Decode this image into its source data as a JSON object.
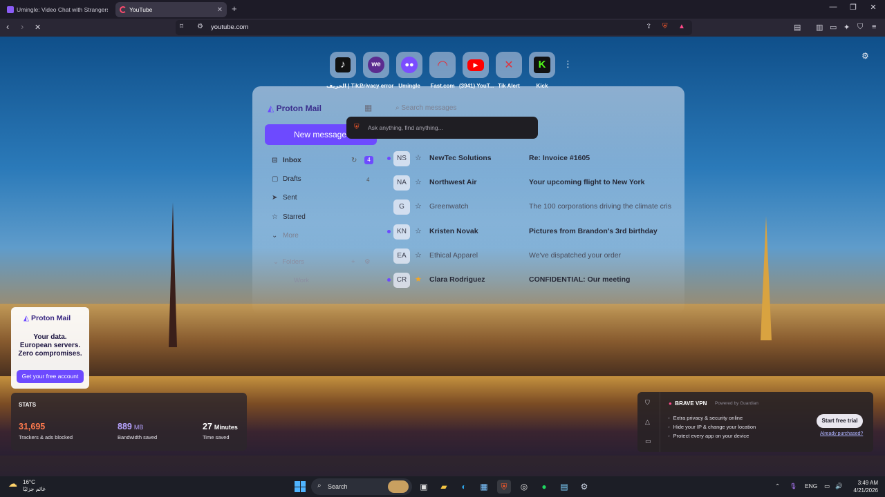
{
  "browser": {
    "tabs": [
      {
        "title": "Umingle: Video Chat with Strangers",
        "active": false
      },
      {
        "title": "YouTube",
        "active": true
      }
    ],
    "url": "youtube.com"
  },
  "speed_dial": [
    {
      "label": "الحريف | Tik...",
      "icon": "tiktok-icon",
      "glyph": "♪"
    },
    {
      "label": "Privacy error",
      "icon": "we-icon",
      "glyph": "we"
    },
    {
      "label": "Umingle",
      "icon": "chat-bubble-icon",
      "glyph": "💬"
    },
    {
      "label": "Fast.com",
      "icon": "speedometer-icon",
      "glyph": "◠"
    },
    {
      "label": "(3941) YouT...",
      "icon": "youtube-icon",
      "glyph": "▶"
    },
    {
      "label": "Tik Alert",
      "icon": "tik-alert-icon",
      "glyph": "✕"
    },
    {
      "label": "Kick",
      "icon": "kick-icon",
      "glyph": "K"
    }
  ],
  "protonmail_preview": {
    "logo": "Proton Mail",
    "search_placeholder": "Search messages",
    "new_message": "New message",
    "nav": [
      {
        "label": "Inbox",
        "count": "4"
      },
      {
        "label": "Drafts",
        "count": "4"
      },
      {
        "label": "Sent",
        "count": ""
      },
      {
        "label": "Starred",
        "count": ""
      },
      {
        "label": "More",
        "count": ""
      }
    ],
    "folders_label": "Folders",
    "folder_work": "Work",
    "messages": [
      {
        "initials": "NS",
        "from": "NewTec Solutions",
        "subject": "Re: Invoice #1605",
        "unread": true
      },
      {
        "initials": "NA",
        "from": "Northwest Air",
        "subject": "Your upcoming flight to New York",
        "unread": true
      },
      {
        "initials": "G",
        "from": "Greenwatch",
        "subject": "The 100 corporations driving the climate cris",
        "unread": false
      },
      {
        "initials": "KN",
        "from": "Kristen Novak",
        "subject": "Pictures from Brandon's 3rd birthday",
        "unread": true
      },
      {
        "initials": "EA",
        "from": "Ethical Apparel",
        "subject": "We've dispatched your order",
        "unread": false
      },
      {
        "initials": "CR",
        "from": "Clara Rodriguez",
        "subject": "CONFIDENTIAL: Our meeting",
        "unread": true
      }
    ]
  },
  "ask_bar": {
    "placeholder": "Ask anything, find anything..."
  },
  "proton_ad": {
    "brand": "Proton Mail",
    "line1": "Your data.",
    "line2": "European servers.",
    "line3": "Zero compromises.",
    "cta": "Get your free account"
  },
  "stats": {
    "header": "STATS",
    "items": [
      {
        "value": "31,695",
        "unit": "",
        "label": "Trackers & ads blocked",
        "color": "#ff7a4d"
      },
      {
        "value": "889",
        "unit": "MB",
        "label": "Bandwidth saved",
        "color": "#b7a3ff"
      },
      {
        "value": "27",
        "unit": "Minutes",
        "label": "Time saved",
        "color": "#ffffff"
      }
    ]
  },
  "vpn": {
    "title": "BRAVE VPN",
    "powered": "Powered by Guardian",
    "features": [
      "Extra privacy & security online",
      "Hide your IP & change your location",
      "Protect every app on your device"
    ],
    "cta": "Start free trial",
    "already": "Already purchased?"
  },
  "taskbar": {
    "temp": "16°C",
    "condition": "غائم جزئيًا",
    "search": "Search",
    "lang": "ENG",
    "time": "3:49 AM",
    "date": "4/21/2026"
  }
}
